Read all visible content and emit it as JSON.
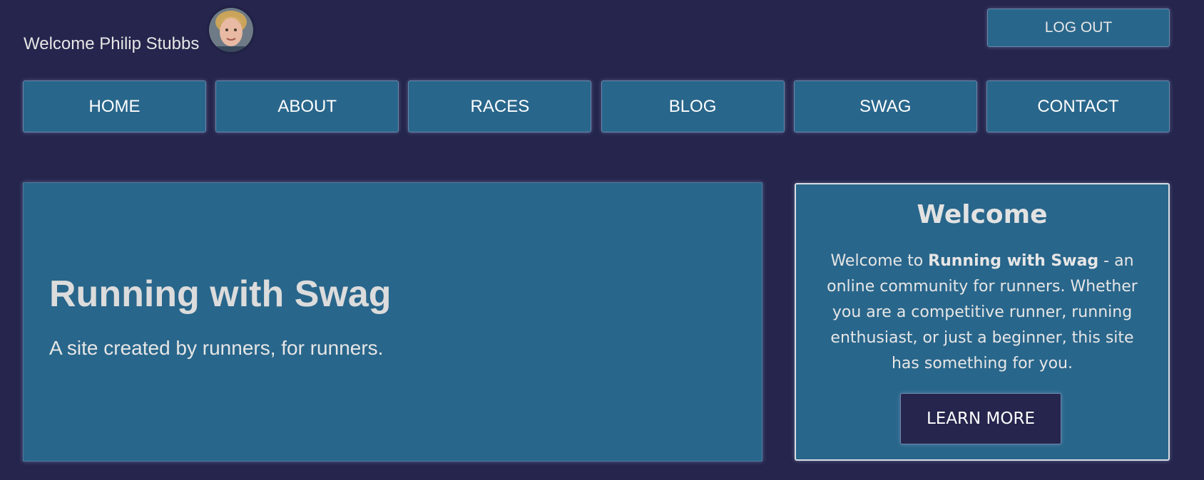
{
  "header": {
    "welcome_text": "Welcome Philip Stubbs",
    "avatar_icon": "user-avatar",
    "logout_label": "LOG OUT"
  },
  "nav": {
    "items": [
      {
        "label": "HOME"
      },
      {
        "label": "ABOUT"
      },
      {
        "label": "RACES"
      },
      {
        "label": "BLOG"
      },
      {
        "label": "SWAG"
      },
      {
        "label": "CONTACT"
      }
    ]
  },
  "hero": {
    "title": "Running with Swag",
    "subtitle": "A site created by runners, for runners."
  },
  "welcome_card": {
    "title": "Welcome",
    "text_before": "Welcome to ",
    "text_bold": "Running with Swag",
    "text_after": " - an online community for runners. Whether you are a competitive runner, running enthusiast, or just a beginner, this site has something for you.",
    "button_label": "LEARN MORE"
  },
  "colors": {
    "background": "#25254d",
    "panel": "#29668b",
    "button_dark": "#25254d"
  }
}
